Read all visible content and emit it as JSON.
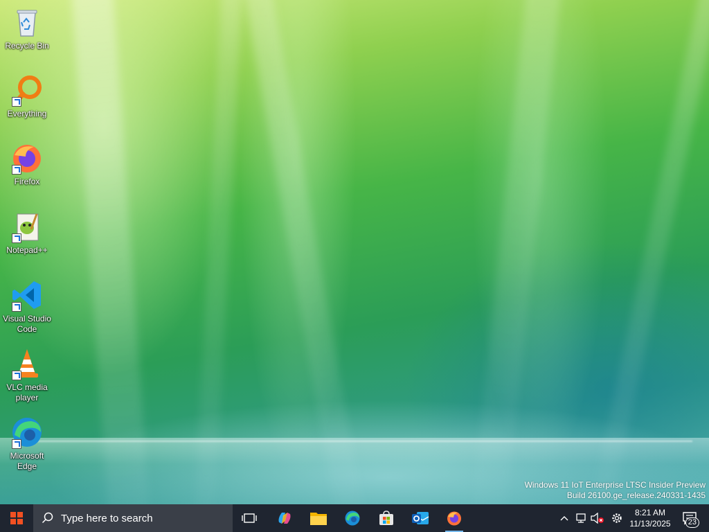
{
  "desktop": {
    "icons": [
      {
        "label": "Recycle Bin",
        "icon": "recycle-bin-icon"
      },
      {
        "label": "Everything",
        "icon": "everything-search-icon"
      },
      {
        "label": "Firefox",
        "icon": "firefox-icon"
      },
      {
        "label": "Notepad++",
        "icon": "notepad-plus-plus-icon"
      },
      {
        "label": "Visual Studio Code",
        "icon": "vscode-icon"
      },
      {
        "label": "VLC media player",
        "icon": "vlc-icon"
      },
      {
        "label": "Microsoft Edge",
        "icon": "edge-icon"
      }
    ],
    "watermark": {
      "line1": "Windows 11 IoT Enterprise LTSC Insider Preview",
      "line2": "Build 26100.ge_release.240331-1435"
    }
  },
  "taskbar": {
    "search_placeholder": "Type here to search",
    "pinned": [
      "task-view-icon",
      "copilot-icon",
      "file-explorer-icon",
      "edge-icon",
      "microsoft-store-icon",
      "outlook-icon",
      "firefox-icon"
    ],
    "active_app": "firefox-icon",
    "tray": {
      "time": "8:21 AM",
      "date": "11/13/2025",
      "notification_count": "23"
    }
  },
  "colors": {
    "taskbar_bg": "#1f2530",
    "search_bg": "#3a3f48",
    "accent": "#76b9ed"
  }
}
